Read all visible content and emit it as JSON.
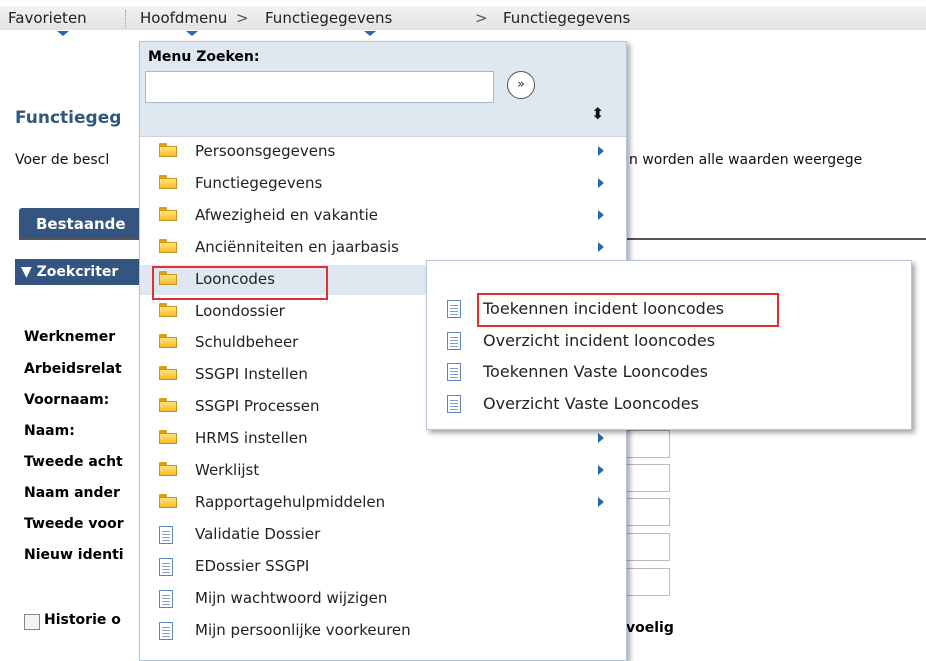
{
  "nav": {
    "favorites": "Favorieten",
    "main_menu": "Hoofdmenu",
    "sep": ">",
    "crumb1": "Functiegegevens",
    "crumb2": "Functiegegevens"
  },
  "page": {
    "title": "Functiegeg",
    "description_left": "Voer de bescl",
    "description_right": "n worden alle waarden weergege",
    "tab_label": "Bestaande",
    "section_label": "▼ Zoekcriter",
    "fields": [
      "Werknemer",
      "Arbeidsrelat",
      "Voornaam:",
      "Naam:",
      "Tweede acht",
      "Naam ander",
      "Tweede voor",
      "Nieuw identi"
    ],
    "history_label": "Historie o",
    "sensitive_label": "voelig"
  },
  "menu": {
    "search_label": "Menu Zoeken:",
    "go_icon": "»",
    "sort_icon": "⬍",
    "items": [
      {
        "label": "Persoonsgegevens",
        "icon": "folder-icon",
        "submenu": true
      },
      {
        "label": "Functiegegevens",
        "icon": "folder-icon",
        "submenu": true
      },
      {
        "label": "Afwezigheid en vakantie",
        "icon": "folder-icon",
        "submenu": true
      },
      {
        "label": "Anciënniteiten en jaarbasis",
        "icon": "folder-icon",
        "submenu": true
      },
      {
        "label": "Looncodes",
        "icon": "folder-icon",
        "submenu": false
      },
      {
        "label": "Loondossier",
        "icon": "folder-icon",
        "submenu": false
      },
      {
        "label": "Schuldbeheer",
        "icon": "folder-icon",
        "submenu": false
      },
      {
        "label": "SSGPI Instellen",
        "icon": "folder-icon",
        "submenu": false
      },
      {
        "label": "SSGPI Processen",
        "icon": "folder-icon",
        "submenu": false
      },
      {
        "label": "HRMS instellen",
        "icon": "folder-icon",
        "submenu": true
      },
      {
        "label": "Werklijst",
        "icon": "folder-icon",
        "submenu": true
      },
      {
        "label": "Rapportagehulpmiddelen",
        "icon": "folder-icon",
        "submenu": true
      },
      {
        "label": "Validatie Dossier",
        "icon": "document-icon",
        "submenu": false
      },
      {
        "label": "EDossier SSGPI",
        "icon": "document-icon",
        "submenu": false
      },
      {
        "label": "Mijn wachtwoord wijzigen",
        "icon": "document-icon",
        "submenu": false
      },
      {
        "label": "Mijn persoonlijke voorkeuren",
        "icon": "document-icon",
        "submenu": false
      }
    ]
  },
  "submenu": {
    "items": [
      {
        "label": "Toekennen incident looncodes",
        "icon": "document-icon"
      },
      {
        "label": "Overzicht incident looncodes",
        "icon": "document-icon"
      },
      {
        "label": "Toekennen Vaste Looncodes",
        "icon": "document-icon"
      },
      {
        "label": "Overzicht Vaste Looncodes",
        "icon": "document-icon"
      }
    ]
  },
  "colors": {
    "accent": "#33557f",
    "highlight_box": "#e03030",
    "menu_header_bg": "#dfe7f1"
  }
}
